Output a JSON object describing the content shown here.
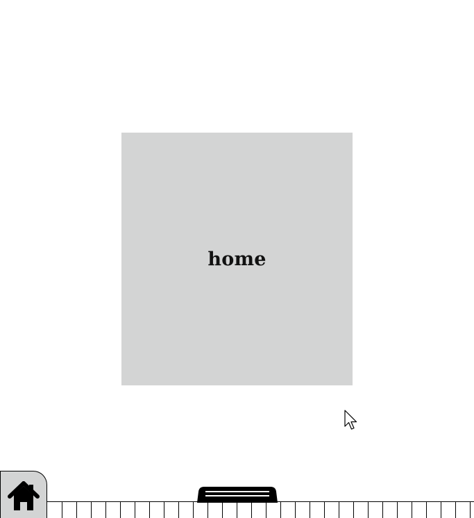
{
  "main": {
    "panel_label": "home"
  },
  "dock": {
    "home_button_icon": "home-icon",
    "handle_icon": "drag-handle-icon"
  },
  "colors": {
    "panel_background": "#d3d4d4",
    "home_button_background": "#d3d4d4",
    "page_background": "#ffffff",
    "ink": "#000000"
  }
}
